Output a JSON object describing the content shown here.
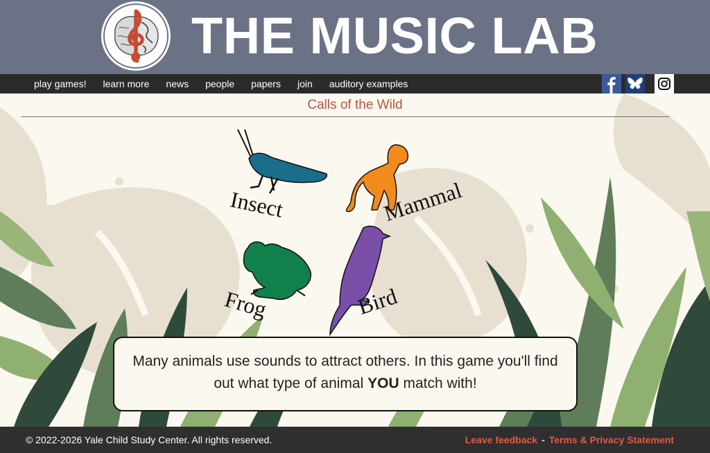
{
  "header": {
    "title": "THE MUSIC LAB",
    "logo_icon": "brain-treble-clef-globe-logo",
    "brand_color": "#6b7286"
  },
  "nav": {
    "items": [
      {
        "label": "play games!"
      },
      {
        "label": "learn more"
      },
      {
        "label": "news"
      },
      {
        "label": "people"
      },
      {
        "label": "papers"
      },
      {
        "label": "join"
      },
      {
        "label": "auditory examples"
      }
    ],
    "social": [
      "facebook-icon",
      "bluesky-icon",
      "instagram-icon"
    ]
  },
  "main": {
    "page_title": "Calls of the Wild",
    "animals": [
      {
        "label": "Insect",
        "icon": "grasshopper-icon",
        "color": "#1a6e8c"
      },
      {
        "label": "Mammal",
        "icon": "monkey-icon",
        "color": "#f28a1c"
      },
      {
        "label": "Frog",
        "icon": "frog-icon",
        "color": "#12804a"
      },
      {
        "label": "Bird",
        "icon": "bird-icon",
        "color": "#7a4fa8"
      }
    ],
    "info": {
      "text_before": "Many animals use sounds to attract others. In this game you'll find out what type of animal ",
      "emphasis": "YOU",
      "text_after": " match with!"
    }
  },
  "footer": {
    "copyright": "© 2022-2026 Yale Child Study Center. All rights reserved.",
    "feedback_link": "Leave feedback",
    "separator": "-",
    "terms_link": "Terms & Privacy Statement",
    "link_color": "#e05a44"
  }
}
